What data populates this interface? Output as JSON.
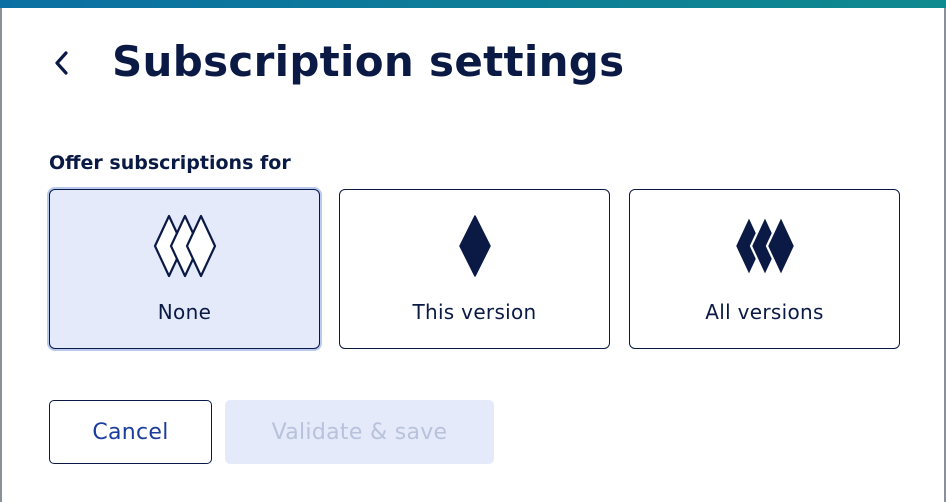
{
  "header": {
    "title": "Subscription settings",
    "back_icon": "chevron-left-icon"
  },
  "subscriptions": {
    "label": "Offer subscriptions for",
    "selected": "None",
    "options": [
      {
        "label": "None",
        "icon": "outlined-diamonds-icon",
        "selected": true
      },
      {
        "label": "This version",
        "icon": "single-diamond-icon",
        "selected": false
      },
      {
        "label": "All versions",
        "icon": "stacked-diamonds-icon",
        "selected": false
      }
    ]
  },
  "actions": {
    "cancel_label": "Cancel",
    "save_label": "Validate & save",
    "save_disabled": true
  },
  "colors": {
    "text": "#0b1a45",
    "accent_link": "#1b3d9c",
    "selected_bg": "#e4eaf9",
    "disabled_text": "#b8c2dc",
    "top_bar_start": "#0b6fa3",
    "top_bar_end": "#0f8a8e"
  }
}
